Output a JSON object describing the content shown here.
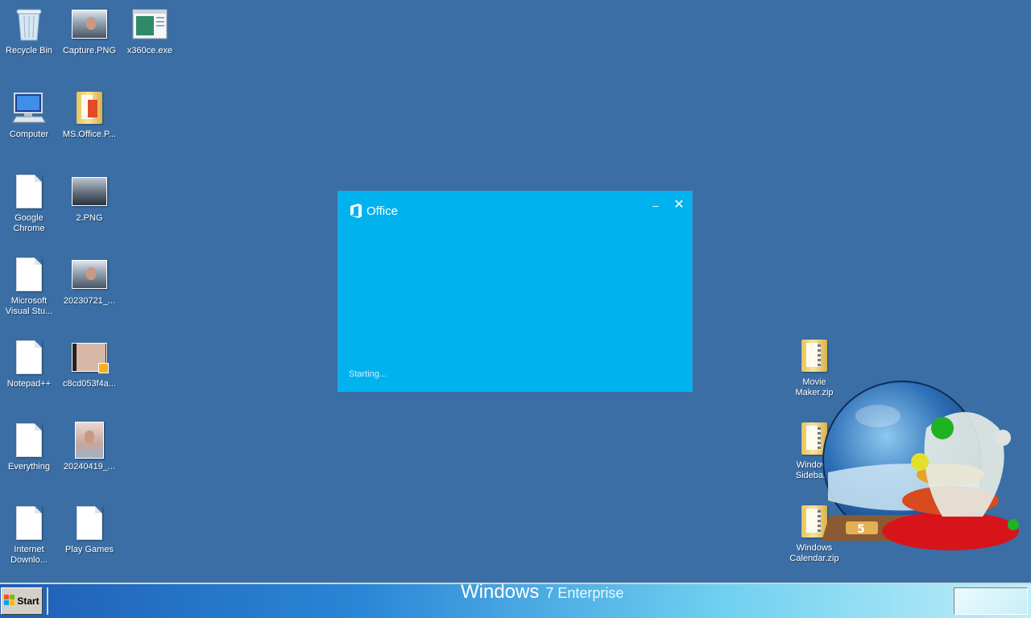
{
  "desktop": {
    "icons_left": [
      {
        "label": "Recycle Bin"
      },
      {
        "label": "Capture.PNG"
      },
      {
        "label": "x360ce.exe"
      },
      {
        "label": "Computer"
      },
      {
        "label": "MS.Office.P..."
      },
      {
        "label": "Google Chrome"
      },
      {
        "label": "2.PNG"
      },
      {
        "label": "Microsoft Visual Stu..."
      },
      {
        "label": "20230721_..."
      },
      {
        "label": "Notepad++"
      },
      {
        "label": "c8cd053f4a..."
      },
      {
        "label": "Everything"
      },
      {
        "label": "20240419_..."
      },
      {
        "label": "Internet Downlo..."
      },
      {
        "label": "Play Games"
      }
    ],
    "icons_right": [
      {
        "label": "Movie Maker.zip"
      },
      {
        "label": "Windows Sidebar..."
      },
      {
        "label": "Windows Calendar.zip"
      }
    ],
    "background_color": "#3a6ea5"
  },
  "splash": {
    "app_name": "Office",
    "status": "Starting...",
    "minimize_glyph": "–",
    "close_glyph": "✕",
    "color": "#00b2ee"
  },
  "gadget": {
    "name": "snow-globe-gadget",
    "badge": "5"
  },
  "taskbar": {
    "start_label": "Start",
    "brand_text": "Windows",
    "brand_sub": "7 Enterprise"
  }
}
